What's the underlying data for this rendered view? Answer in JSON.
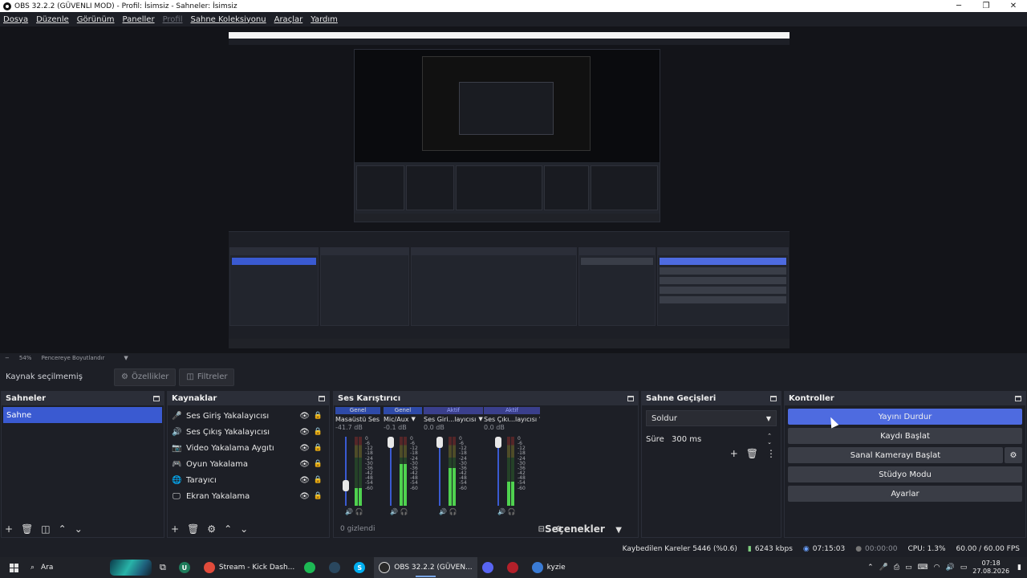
{
  "window": {
    "title": "OBS 32.2.2 (GÜVENLI MOD) - Profil: İsimsiz - Sahneler: İsimsiz"
  },
  "menu": [
    "Dosya",
    "Düzenle",
    "Görünüm",
    "Paneller",
    "Profil",
    "Sahne Koleksiyonu",
    "Araçlar",
    "Yardım"
  ],
  "zoom": {
    "minus": "−",
    "level": "54%",
    "mode": "Pencereye Boyutlandır"
  },
  "source_toolbar": {
    "no_selection": "Kaynak seçilmemiş",
    "properties": "Özellikler",
    "filters": "Filtreler"
  },
  "scenes": {
    "title": "Sahneler",
    "items": [
      "Sahne"
    ]
  },
  "sources": {
    "title": "Kaynaklar",
    "items": [
      {
        "name": "Ses Giriş Yakalayıcısı",
        "icon": "microphone-icon",
        "glyph": "🎤"
      },
      {
        "name": "Ses Çıkış Yakalayıcısı",
        "icon": "speaker-icon",
        "glyph": "🔊"
      },
      {
        "name": "Video Yakalama Aygıtı",
        "icon": "camera-icon",
        "glyph": "📷"
      },
      {
        "name": "Oyun Yakalama",
        "icon": "gamepad-icon",
        "glyph": "🎮"
      },
      {
        "name": "Tarayıcı",
        "icon": "globe-icon",
        "glyph": "🌐"
      },
      {
        "name": "Ekran Yakalama",
        "icon": "monitor-icon",
        "glyph": "🖵"
      }
    ]
  },
  "mixer": {
    "title": "Ses Karıştırıcı",
    "hidden": "0 gizlendi",
    "options": "Seçenekler",
    "ticks": [
      "0",
      "-6",
      "-12",
      "-18",
      "-24",
      "-30",
      "-36",
      "-42",
      "-48",
      "-54",
      "-60"
    ],
    "channels": [
      {
        "tag": "Genel",
        "name": "Masaüstü Ses",
        "db": "-41.7 dB",
        "level": 0.25,
        "fader": 0.25
      },
      {
        "tag": "Genel",
        "name": "Mic/Aux",
        "db": "-0.1 dB",
        "level": 0.6,
        "fader": 1.0
      },
      {
        "tag": "Aktif",
        "name": "Ses Giri...layıcısı",
        "db": "0.0 dB",
        "level": 0.55,
        "fader": 1.0
      },
      {
        "tag": "Aktif",
        "name": "Ses Çıkı...layıcısı",
        "db": "0.0 dB",
        "level": 0.35,
        "fader": 1.0
      }
    ]
  },
  "transitions": {
    "title": "Sahne Geçişleri",
    "selected": "Soldur",
    "duration_label": "Süre",
    "duration": "300 ms"
  },
  "controls": {
    "title": "Kontroller",
    "buttons": [
      "Yayını Durdur",
      "Kaydı Başlat",
      "Sanal Kamerayı Başlat",
      "Stüdyo Modu",
      "Ayarlar"
    ]
  },
  "status": {
    "dropped": "Kaybedilen Kareler 5446 (%0.6)",
    "bitrate": "6243 kbps",
    "stream_time": "07:15:03",
    "rec_time": "00:00:00",
    "cpu": "CPU: 1.3%",
    "fps": "60.00 / 60.00 FPS"
  },
  "taskbar": {
    "search": "Ara",
    "apps": [
      {
        "label": "Stream - Kick Dash...",
        "icon": "chrome-icon",
        "color": "#e14b3b"
      },
      {
        "label": "OBS 32.2.2 (GÜVEN...",
        "icon": "obs-icon",
        "color": "#2a2a2a"
      },
      {
        "label": "kyzie",
        "icon": "app-icon",
        "color": "#3a7bd5"
      }
    ],
    "time": "07:18",
    "date": "27.08.2026"
  }
}
